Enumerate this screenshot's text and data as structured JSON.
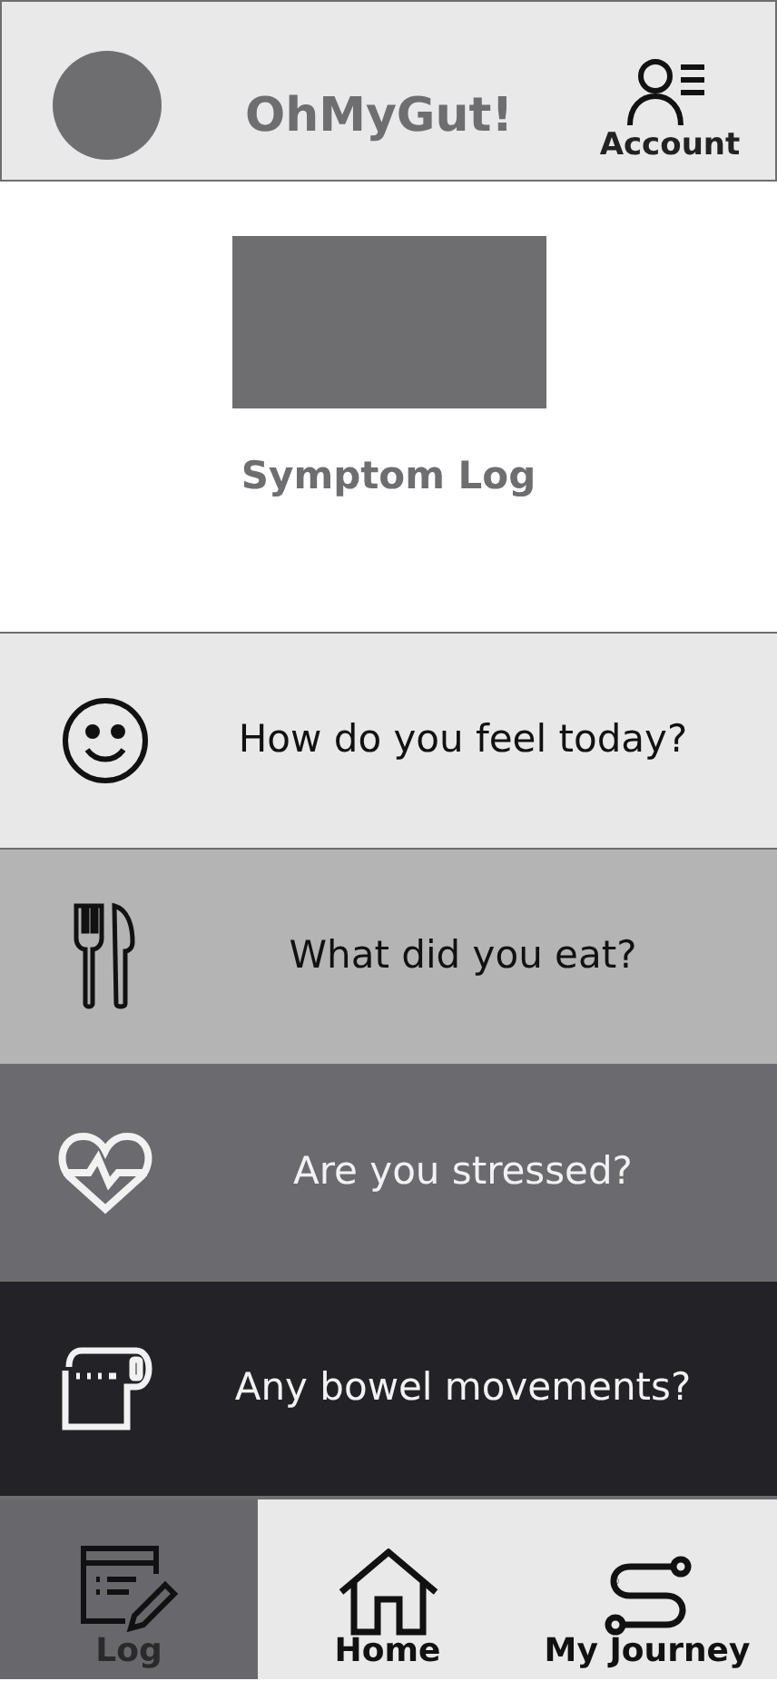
{
  "header": {
    "title": "OhMyGut!",
    "account_label": "Account"
  },
  "page": {
    "title": "Symptom Log"
  },
  "questions": [
    {
      "kind": "smiley",
      "label": "How do you feel today?",
      "color": "#e8e8e8"
    },
    {
      "kind": "cutlery",
      "label": "What did you eat?",
      "color": "#b4b4b5"
    },
    {
      "kind": "heart",
      "label": "Are you stressed?",
      "color": "#6b6a6e"
    },
    {
      "kind": "toilet-paper",
      "label": "Any bowel movements?",
      "color": "#232226"
    }
  ],
  "nav": [
    {
      "kind": "log",
      "label": "Log",
      "selected": true
    },
    {
      "kind": "home",
      "label": "Home",
      "selected": false
    },
    {
      "kind": "journey",
      "label": "My Journey",
      "selected": false
    }
  ]
}
